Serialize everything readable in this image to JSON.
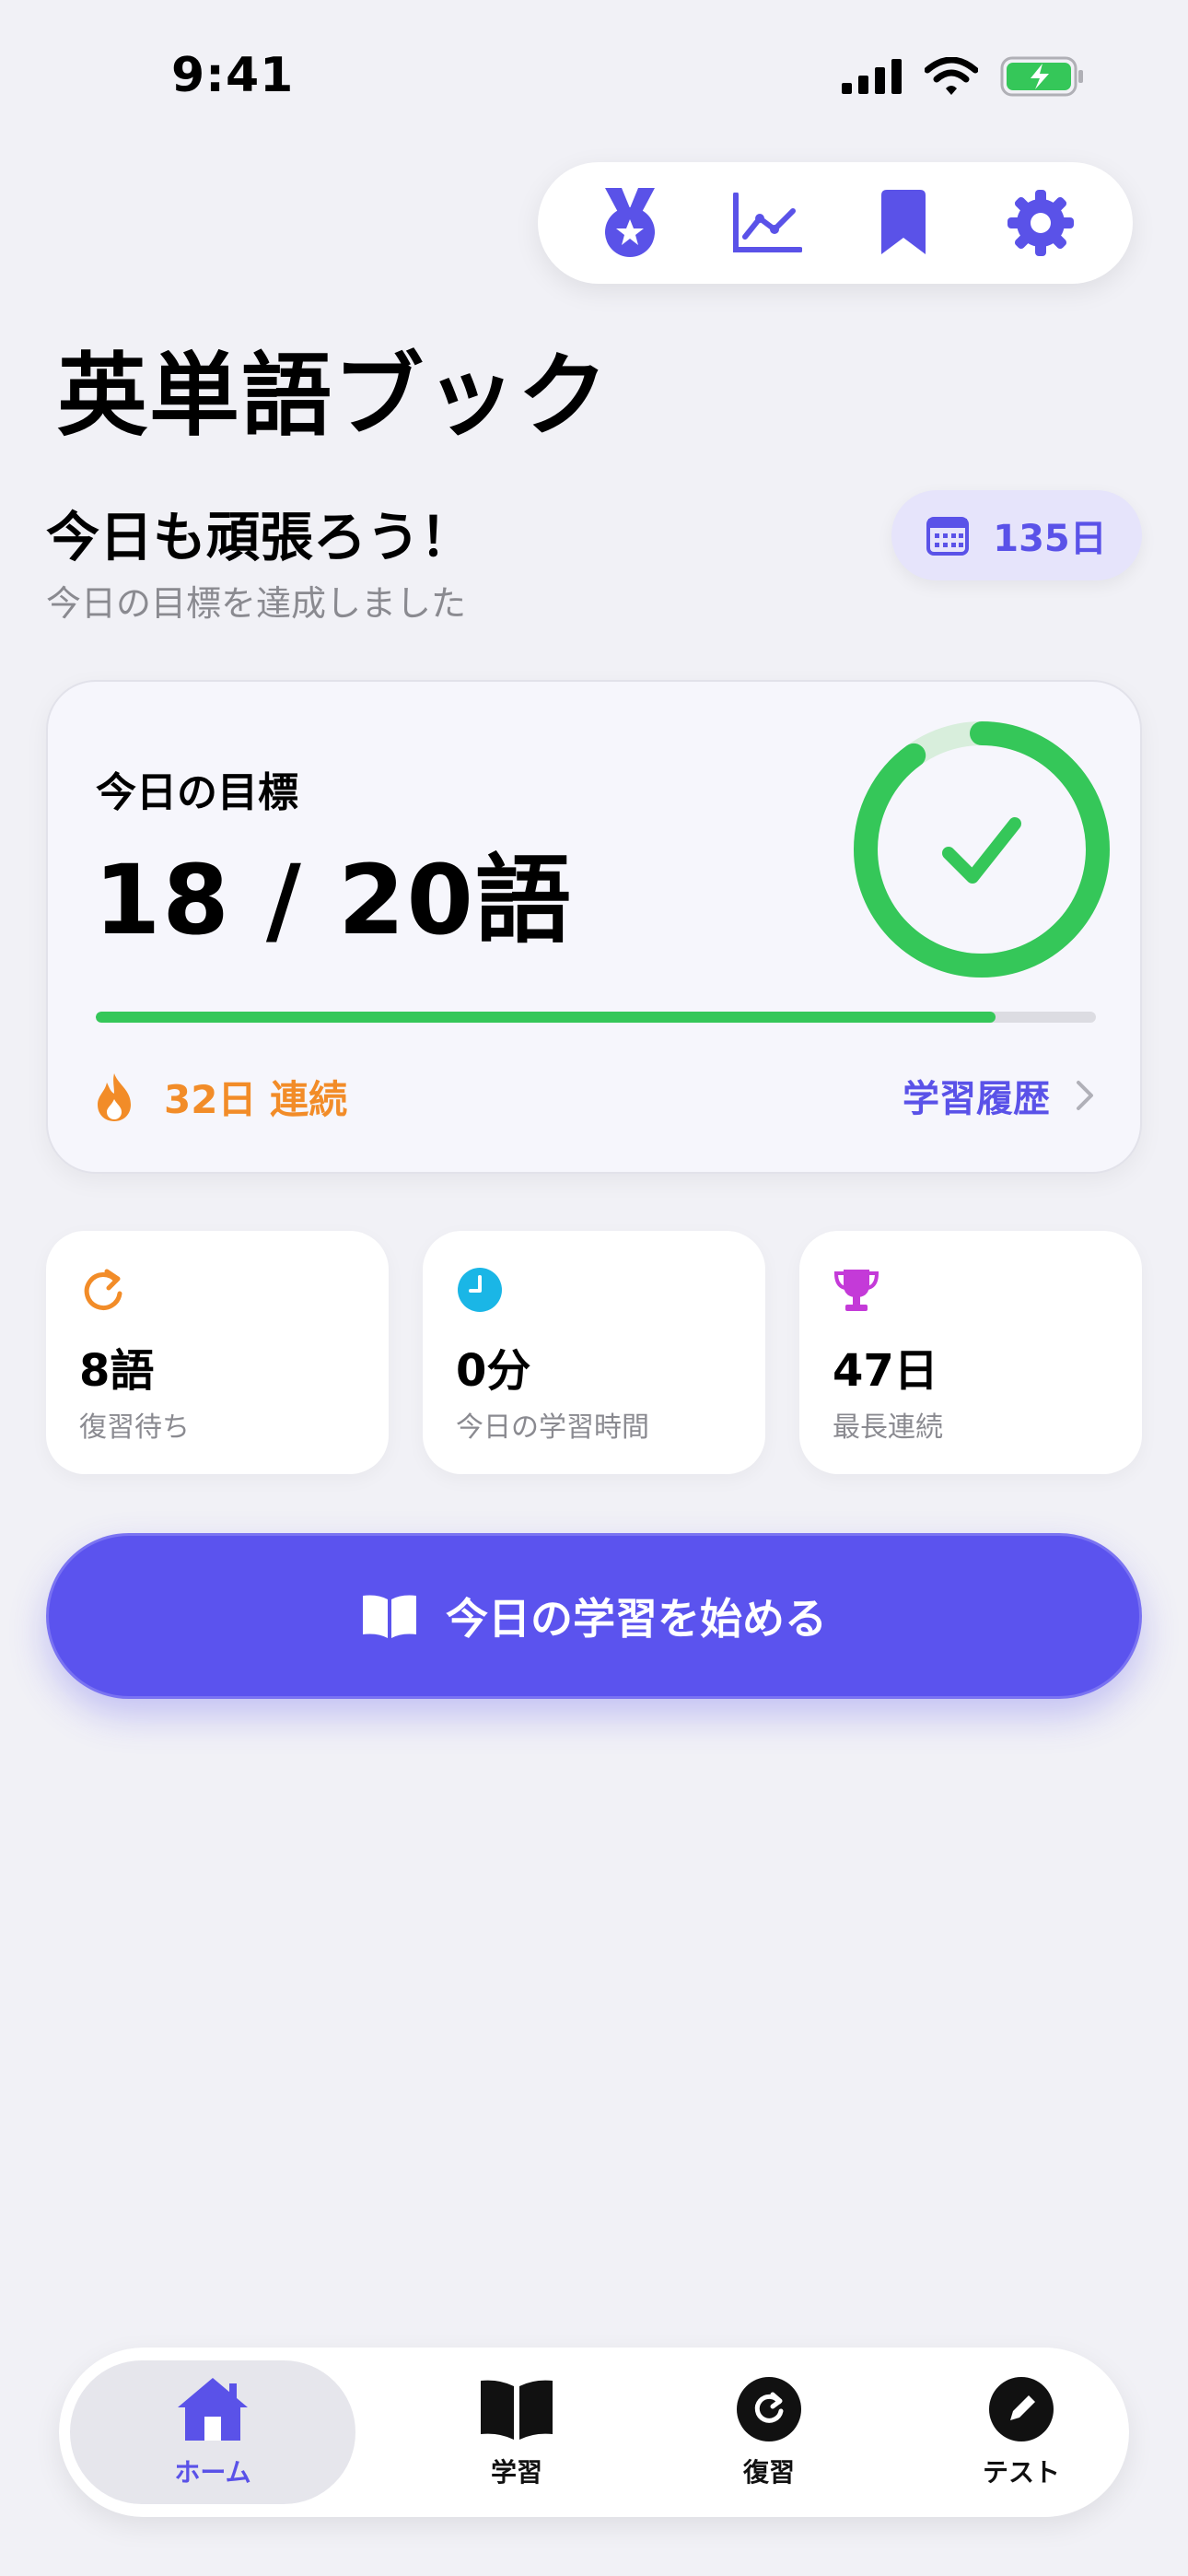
{
  "status_bar": {
    "time": "9:41"
  },
  "toolbar": {
    "items": [
      {
        "icon": "medal-icon"
      },
      {
        "icon": "chart-icon"
      },
      {
        "icon": "bookmark-icon"
      },
      {
        "icon": "gear-icon"
      }
    ],
    "accent": "#5a52e8"
  },
  "header": {
    "title": "英単語ブック",
    "greeting": "今日も頑張ろう！",
    "subgreeting": "今日の目標を達成しました",
    "days_chip": "135日"
  },
  "goal_card": {
    "label": "今日の目標",
    "value": "18 / 20語",
    "progress": 0.9,
    "streak": "32日 連続",
    "history_link": "学習履歴"
  },
  "stats": [
    {
      "icon": "refresh-icon",
      "value": "8語",
      "label": "復習待ち",
      "color": "#f28c28"
    },
    {
      "icon": "clock-icon",
      "value": "0分",
      "label": "今日の学習時間",
      "color": "#1ab6e6"
    },
    {
      "icon": "trophy-icon",
      "value": "47日",
      "label": "最長連続",
      "color": "#c43ad8"
    }
  ],
  "start_button": {
    "label": "今日の学習を始める"
  },
  "tabbar": {
    "items": [
      {
        "label": "ホーム",
        "icon": "home-icon",
        "active": true
      },
      {
        "label": "学習",
        "icon": "book-icon",
        "active": false
      },
      {
        "label": "復習",
        "icon": "refresh-icon",
        "active": false
      },
      {
        "label": "テスト",
        "icon": "pencil-icon",
        "active": false
      }
    ]
  },
  "colors": {
    "accent": "#5b53ee",
    "success": "#35c759",
    "streak": "#f28c28",
    "background": "#f1f1f6"
  }
}
